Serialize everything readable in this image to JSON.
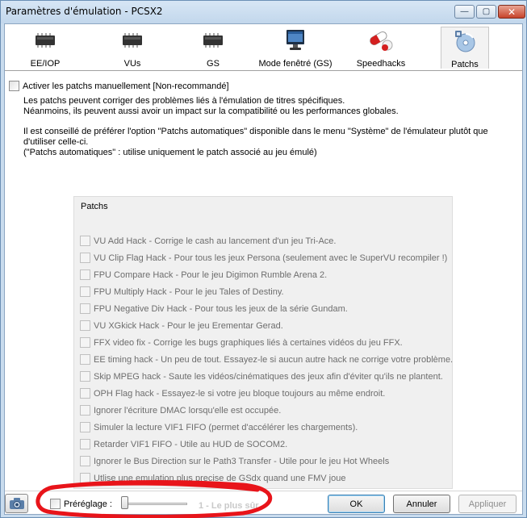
{
  "window": {
    "title": "Paramètres d'émulation - PCSX2",
    "minimize_glyph": "—",
    "maximize_glyph": "▢",
    "close_glyph": "✕"
  },
  "tabs": [
    {
      "label": "EE/IOP",
      "icon": "chip-icon"
    },
    {
      "label": "VUs",
      "icon": "chip-icon"
    },
    {
      "label": "GS",
      "icon": "chip-icon"
    },
    {
      "label": "Mode fenêtré (GS)",
      "icon": "monitor-icon"
    },
    {
      "label": "Speedhacks",
      "icon": "pill-icon"
    },
    {
      "label": "Patchs",
      "icon": "disc-icon",
      "active": true
    }
  ],
  "manual": {
    "label": "Activer les patchs manuellement [Non-recommandé]",
    "checked": false
  },
  "description": {
    "line1": "Les patchs peuvent corriger des problèmes liés à l'émulation de titres spécifiques.",
    "line2": "Néanmoins, ils peuvent aussi avoir un impact sur la compatibilité ou les performances globales.",
    "line3": "Il est conseillé de préférer l'option \"Patchs automatiques\" disponible dans le menu \"Système\" de l'émulateur plutôt que",
    "line4": "d'utiliser celle-ci.",
    "line5": "(\"Patchs automatiques\" : utilise uniquement le patch associé au jeu émulé)"
  },
  "patches": {
    "title": "Patchs",
    "items": [
      "VU Add Hack - Corrige le cash au lancement d'un jeu Tri-Ace.",
      "VU Clip Flag Hack - Pour tous les jeux Persona (seulement avec le SuperVU recompiler !)",
      "FPU Compare Hack - Pour le jeu Digimon Rumble Arena 2.",
      "FPU Multiply Hack - Pour le jeu Tales of Destiny.",
      "FPU Negative Div Hack - Pour tous les jeux de la série Gundam.",
      "VU XGkick Hack - Pour le jeu Erementar Gerad.",
      "FFX video fix - Corrige les bugs graphiques liés à certaines vidéos du jeu FFX.",
      "EE timing hack - Un peu de tout. Essayez-le si aucun autre hack ne corrige votre problème.",
      "Skip MPEG hack - Saute les vidéos/cinématiques des jeux afin d'éviter qu'ils ne plantent.",
      "OPH Flag hack - Essayez-le si votre jeu bloque toujours au même endroit.",
      "Ignorer l'écriture DMAC lorsqu'elle est occupée.",
      "Simuler la lecture VIF1 FIFO (permet d'accélérer les chargements).",
      "Retarder VIF1 FIFO - Utile au HUD de SOCOM2.",
      "Ignorer le Bus Direction sur le Path3 Transfer - Utile pour le jeu Hot Wheels",
      "Utlise une emulation plus precise de GSdx quand une FMV joue"
    ]
  },
  "footer": {
    "preset_label": "Préréglage :",
    "preset_level": "1 - Le plus sûr",
    "preset_slider_value": 0,
    "ok": "OK",
    "cancel": "Annuler",
    "apply": "Appliquer",
    "annotation_color": "#e8141a"
  }
}
